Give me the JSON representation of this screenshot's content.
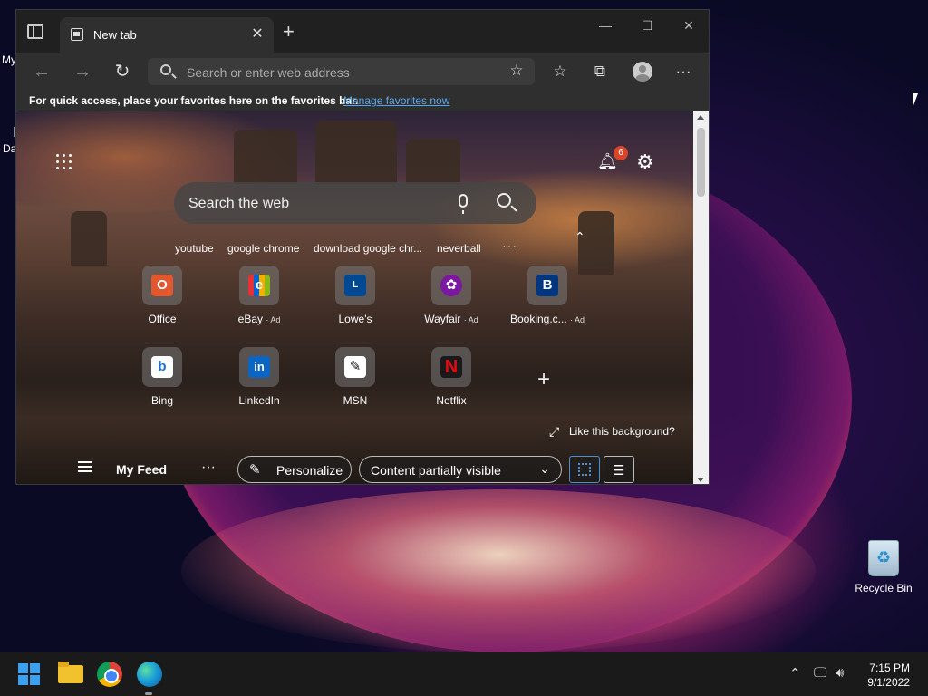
{
  "desktop": {
    "left_fragment_1": "My",
    "left_fragment_2": "I",
    "left_fragment_3": "Da",
    "recycle_bin_label": "Recycle Bin"
  },
  "browser": {
    "tab_title": "New tab",
    "tab_close": "✕",
    "new_tab": "+",
    "window_controls": {
      "minimize": "—",
      "maximize": "☐",
      "close": "✕"
    },
    "address_placeholder": "Search or enter web address",
    "favorites_bar": {
      "message": "For quick access, place your favorites here on the favorites bar.",
      "link": "Manage favorites now"
    },
    "toolbar_icons": [
      "add-favorite-icon",
      "favorites-icon",
      "collections-icon",
      "profile-icon",
      "more-icon"
    ]
  },
  "newtab": {
    "notification_count": "6",
    "search_placeholder": "Search the web",
    "trending": [
      "youtube",
      "google chrome",
      "download google chr...",
      "neverball"
    ],
    "trending_more": "···",
    "top_sites_row1": [
      {
        "label": "Office",
        "ad": "",
        "icon": "office-icon",
        "glyph": "O",
        "color": "#e2572d"
      },
      {
        "label": "eBay",
        "ad": "· Ad",
        "icon": "ebay-icon",
        "glyph": "e",
        "color": "#e53238"
      },
      {
        "label": "Lowe's",
        "ad": "",
        "icon": "lowes-icon",
        "glyph": "L",
        "color": "#004990"
      },
      {
        "label": "Wayfair",
        "ad": "· Ad",
        "icon": "wayfair-icon",
        "glyph": "✿",
        "color": "#7b189f"
      },
      {
        "label": "Booking.c...",
        "ad": "· Ad",
        "icon": "booking-icon",
        "glyph": "B",
        "color": "#003580"
      }
    ],
    "top_sites_row2": [
      {
        "label": "Bing",
        "icon": "bing-icon",
        "glyph": "b",
        "color": "#ffffff",
        "fg": "#1b72d0"
      },
      {
        "label": "LinkedIn",
        "icon": "linkedin-icon",
        "glyph": "in",
        "color": "#0a66c2",
        "fg": "#ffffff"
      },
      {
        "label": "MSN",
        "icon": "msn-icon",
        "glyph": "✎",
        "color": "#ffffff",
        "fg": "#111111"
      },
      {
        "label": "Netflix",
        "icon": "netflix-icon",
        "glyph": "N",
        "color": "#1a1a1a",
        "fg": "#e50914"
      }
    ],
    "add_site": "+",
    "like_background": "Like this background?",
    "feed": {
      "title": "My Feed",
      "more": "···",
      "personalize": "Personalize",
      "content_visibility": "Content partially visible"
    }
  },
  "taskbar": {
    "time": "7:15 PM",
    "date": "9/1/2022",
    "apps": [
      "start-icon",
      "file-explorer-icon",
      "chrome-icon",
      "edge-icon"
    ]
  }
}
